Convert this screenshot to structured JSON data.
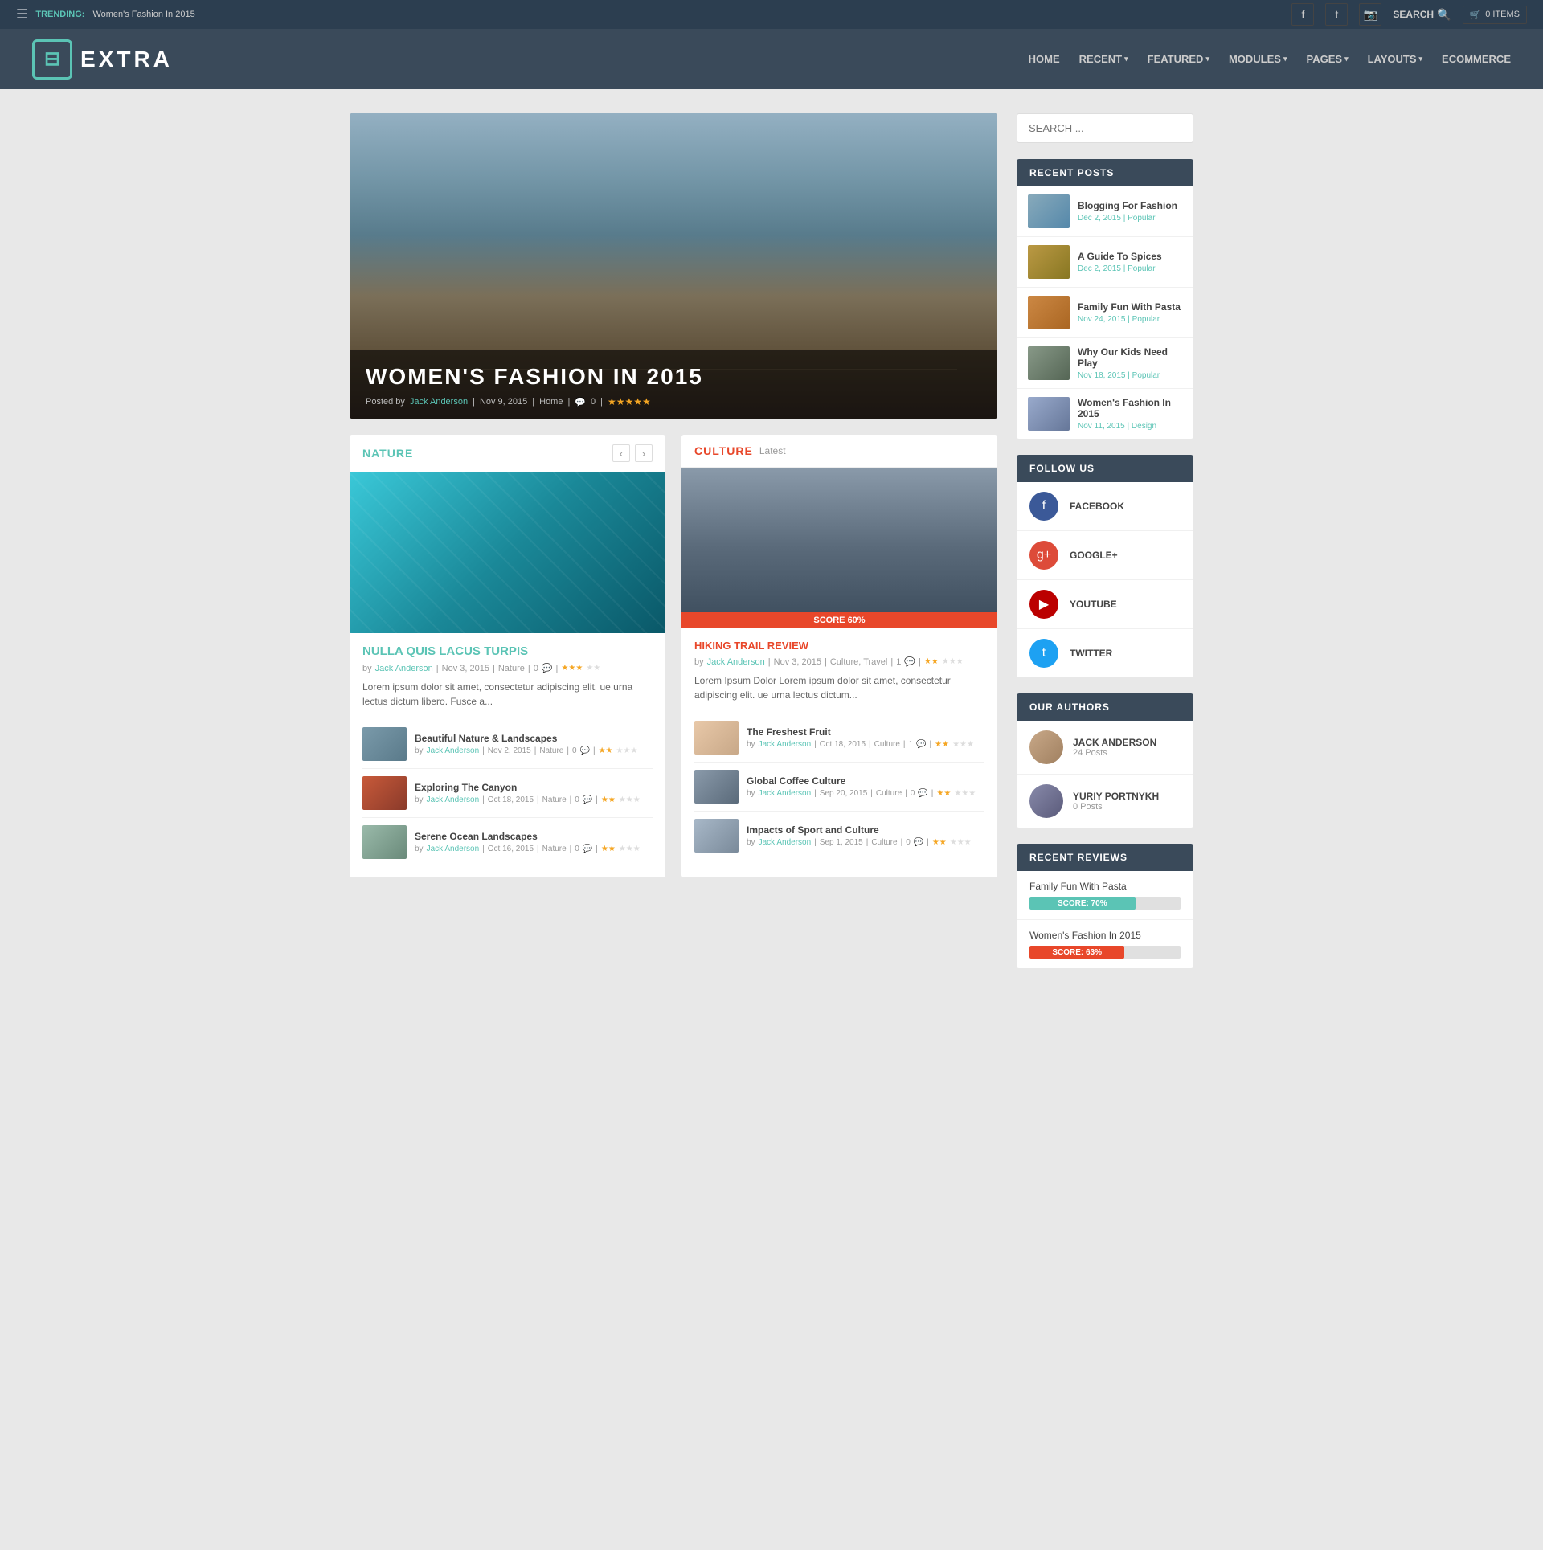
{
  "topbar": {
    "trending_label": "TRENDING:",
    "trending_text": "Women's Fashion In 2015",
    "search_label": "SEARCH",
    "cart_label": "0 ITEMS"
  },
  "header": {
    "logo_text": "EXTRA",
    "nav": [
      {
        "label": "HOME",
        "has_arrow": false
      },
      {
        "label": "RECENT",
        "has_arrow": true
      },
      {
        "label": "FEATURED",
        "has_arrow": true
      },
      {
        "label": "MODULES",
        "has_arrow": true
      },
      {
        "label": "PAGES",
        "has_arrow": true
      },
      {
        "label": "LAYOUTS",
        "has_arrow": true
      },
      {
        "label": "ECOMMERCE",
        "has_arrow": false
      }
    ]
  },
  "hero": {
    "title": "WOMEN'S FASHION IN 2015",
    "meta_posted": "Posted by",
    "meta_author": "Jack Anderson",
    "meta_date": "Nov 9, 2015",
    "meta_category": "Home",
    "meta_comments": "0",
    "stars": "★★★★★"
  },
  "nature_section": {
    "title": "NATURE",
    "main_post": {
      "title": "NULLA QUIS LACUS TURPIS",
      "author": "Jack Anderson",
      "date": "Nov 3, 2015",
      "category": "Nature",
      "comments": "0",
      "stars_filled": 3,
      "stars_empty": 2,
      "excerpt": "Lorem ipsum dolor sit amet, consectetur adipiscing elit. ue urna lectus dictum libero. Fusce a..."
    },
    "small_posts": [
      {
        "title": "Beautiful Nature & Landscapes",
        "author": "Jack Anderson",
        "date": "Nov 2, 2015",
        "category": "Nature",
        "comments": "0",
        "stars_filled": 2,
        "stars_empty": 3
      },
      {
        "title": "Exploring The Canyon",
        "author": "Jack Anderson",
        "date": "Oct 18, 2015",
        "category": "Nature",
        "comments": "0",
        "stars_filled": 2,
        "stars_empty": 3
      },
      {
        "title": "Serene Ocean Landscapes",
        "author": "Jack Anderson",
        "date": "Oct 16, 2015",
        "category": "Nature",
        "comments": "0",
        "stars_filled": 2,
        "stars_empty": 3
      }
    ]
  },
  "culture_section": {
    "title": "CULTURE",
    "subtitle": "Latest",
    "featured_post": {
      "title": "HIKING TRAIL REVIEW",
      "score": "SCORE 60%",
      "author": "Jack Anderson",
      "date": "Nov 3, 2015",
      "categories": "Culture, Travel",
      "comments": "1",
      "stars_filled": 2,
      "stars_empty": 3,
      "excerpt": "Lorem Ipsum Dolor Lorem ipsum dolor sit amet, consectetur adipiscing elit. ue urna lectus dictum..."
    },
    "small_posts": [
      {
        "title": "The Freshest Fruit",
        "author": "Jack Anderson",
        "date": "Oct 18, 2015",
        "category": "Culture",
        "comments": "1",
        "stars_filled": 2,
        "stars_empty": 3
      },
      {
        "title": "Global Coffee Culture",
        "author": "Jack Anderson",
        "date": "Sep 20, 2015",
        "category": "Culture",
        "comments": "0",
        "stars_filled": 2,
        "stars_empty": 3
      },
      {
        "title": "Impacts of Sport and Culture",
        "author": "Jack Anderson",
        "date": "Sep 1, 2015",
        "category": "Culture",
        "comments": "0",
        "stars_filled": 2,
        "stars_empty": 3
      }
    ]
  },
  "sidebar": {
    "search_placeholder": "SEARCH ...",
    "recent_posts_header": "RECENT POSTS",
    "recent_posts": [
      {
        "title": "Blogging For Fashion",
        "date": "Dec 2, 2015",
        "tag": "Popular"
      },
      {
        "title": "A Guide To Spices",
        "date": "Dec 2, 2015",
        "tag": "Popular"
      },
      {
        "title": "Family Fun With Pasta",
        "date": "Nov 24, 2015",
        "tag": "Popular"
      },
      {
        "title": "Why Our Kids Need Play",
        "date": "Nov 18, 2015",
        "tag": "Popular"
      },
      {
        "title": "Women's Fashion In 2015",
        "date": "Nov 11, 2015",
        "tag": "Design"
      }
    ],
    "follow_header": "FOLLOW US",
    "follow_items": [
      {
        "platform": "FACEBOOK",
        "icon": "f"
      },
      {
        "platform": "GOOGLE+",
        "icon": "g+"
      },
      {
        "platform": "YOUTUBE",
        "icon": "▶"
      },
      {
        "platform": "TWITTER",
        "icon": "t"
      }
    ],
    "authors_header": "OUR AUTHORS",
    "authors": [
      {
        "name": "JACK ANDERSON",
        "posts": "24 Posts"
      },
      {
        "name": "YURIY PORTNYKH",
        "posts": "0 Posts"
      }
    ],
    "reviews_header": "RECENT REVIEWS",
    "reviews": [
      {
        "title": "Family Fun With Pasta",
        "score_label": "SCORE: 70%",
        "score": 70,
        "color": "teal"
      },
      {
        "title": "Women's Fashion In 2015",
        "score_label": "SCORE: 63%",
        "score": 63,
        "color": "pink"
      }
    ]
  }
}
